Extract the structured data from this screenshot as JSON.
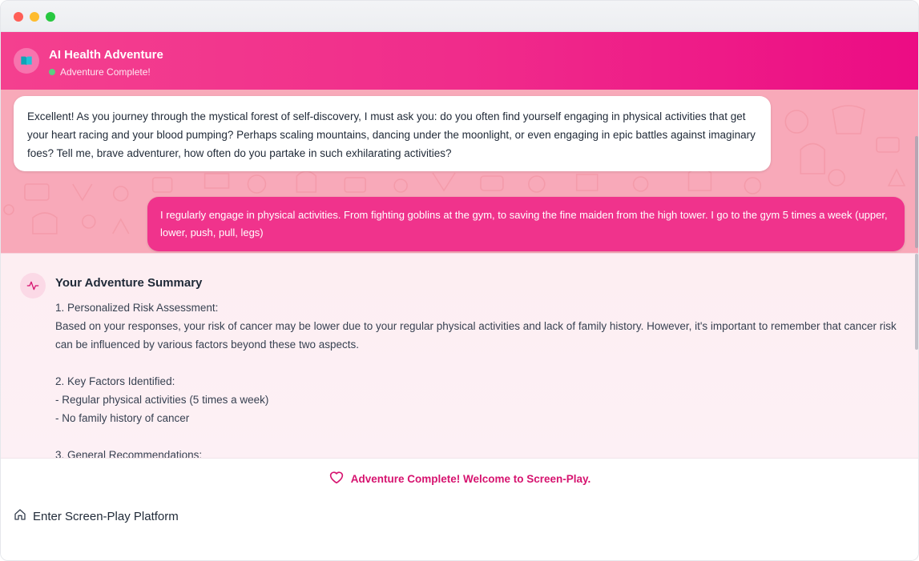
{
  "app": {
    "title": "AI Health Adventure",
    "status": "Adventure Complete!"
  },
  "chat": {
    "messages": [
      {
        "role": "assistant",
        "text": "Excellent! As you journey through the mystical forest of self-discovery, I must ask you: do you often find yourself engaging in physical activities that get your heart racing and your blood pumping? Perhaps scaling mountains, dancing under the moonlight, or even engaging in epic battles against imaginary foes? Tell me, brave adventurer, how often do you partake in such exhilarating activities?"
      },
      {
        "role": "user",
        "text": "I regularly engage in physical activities. From fighting goblins at the gym, to saving the fine maiden from the high tower. I go to the gym 5 times a week (upper, lower, push, pull, legs)"
      }
    ]
  },
  "summary": {
    "title": "Your Adventure Summary",
    "body": "1. Personalized Risk Assessment:\nBased on your responses, your risk of cancer may be lower due to your regular physical activities and lack of family history. However, it's important to remember that cancer risk can be influenced by various factors beyond these two aspects.\n\n2. Key Factors Identified:\n- Regular physical activities (5 times a week)\n- No family history of cancer\n\n3. General Recommendations:"
  },
  "footer": {
    "complete_message": "Adventure Complete! Welcome to Screen-Play.",
    "enter_button": "Enter Screen-Play Platform"
  },
  "icons": {
    "app": "book-icon",
    "summary": "activity-pulse-icon",
    "complete": "heart-icon",
    "enter": "home-icon"
  },
  "colors": {
    "header_start": "#f4408f",
    "header_end": "#ec0c84",
    "user_bubble": "#f0338c",
    "chat_background": "#f8a9b9",
    "accent_text": "#d6136f",
    "status_dot": "#4ade80"
  }
}
